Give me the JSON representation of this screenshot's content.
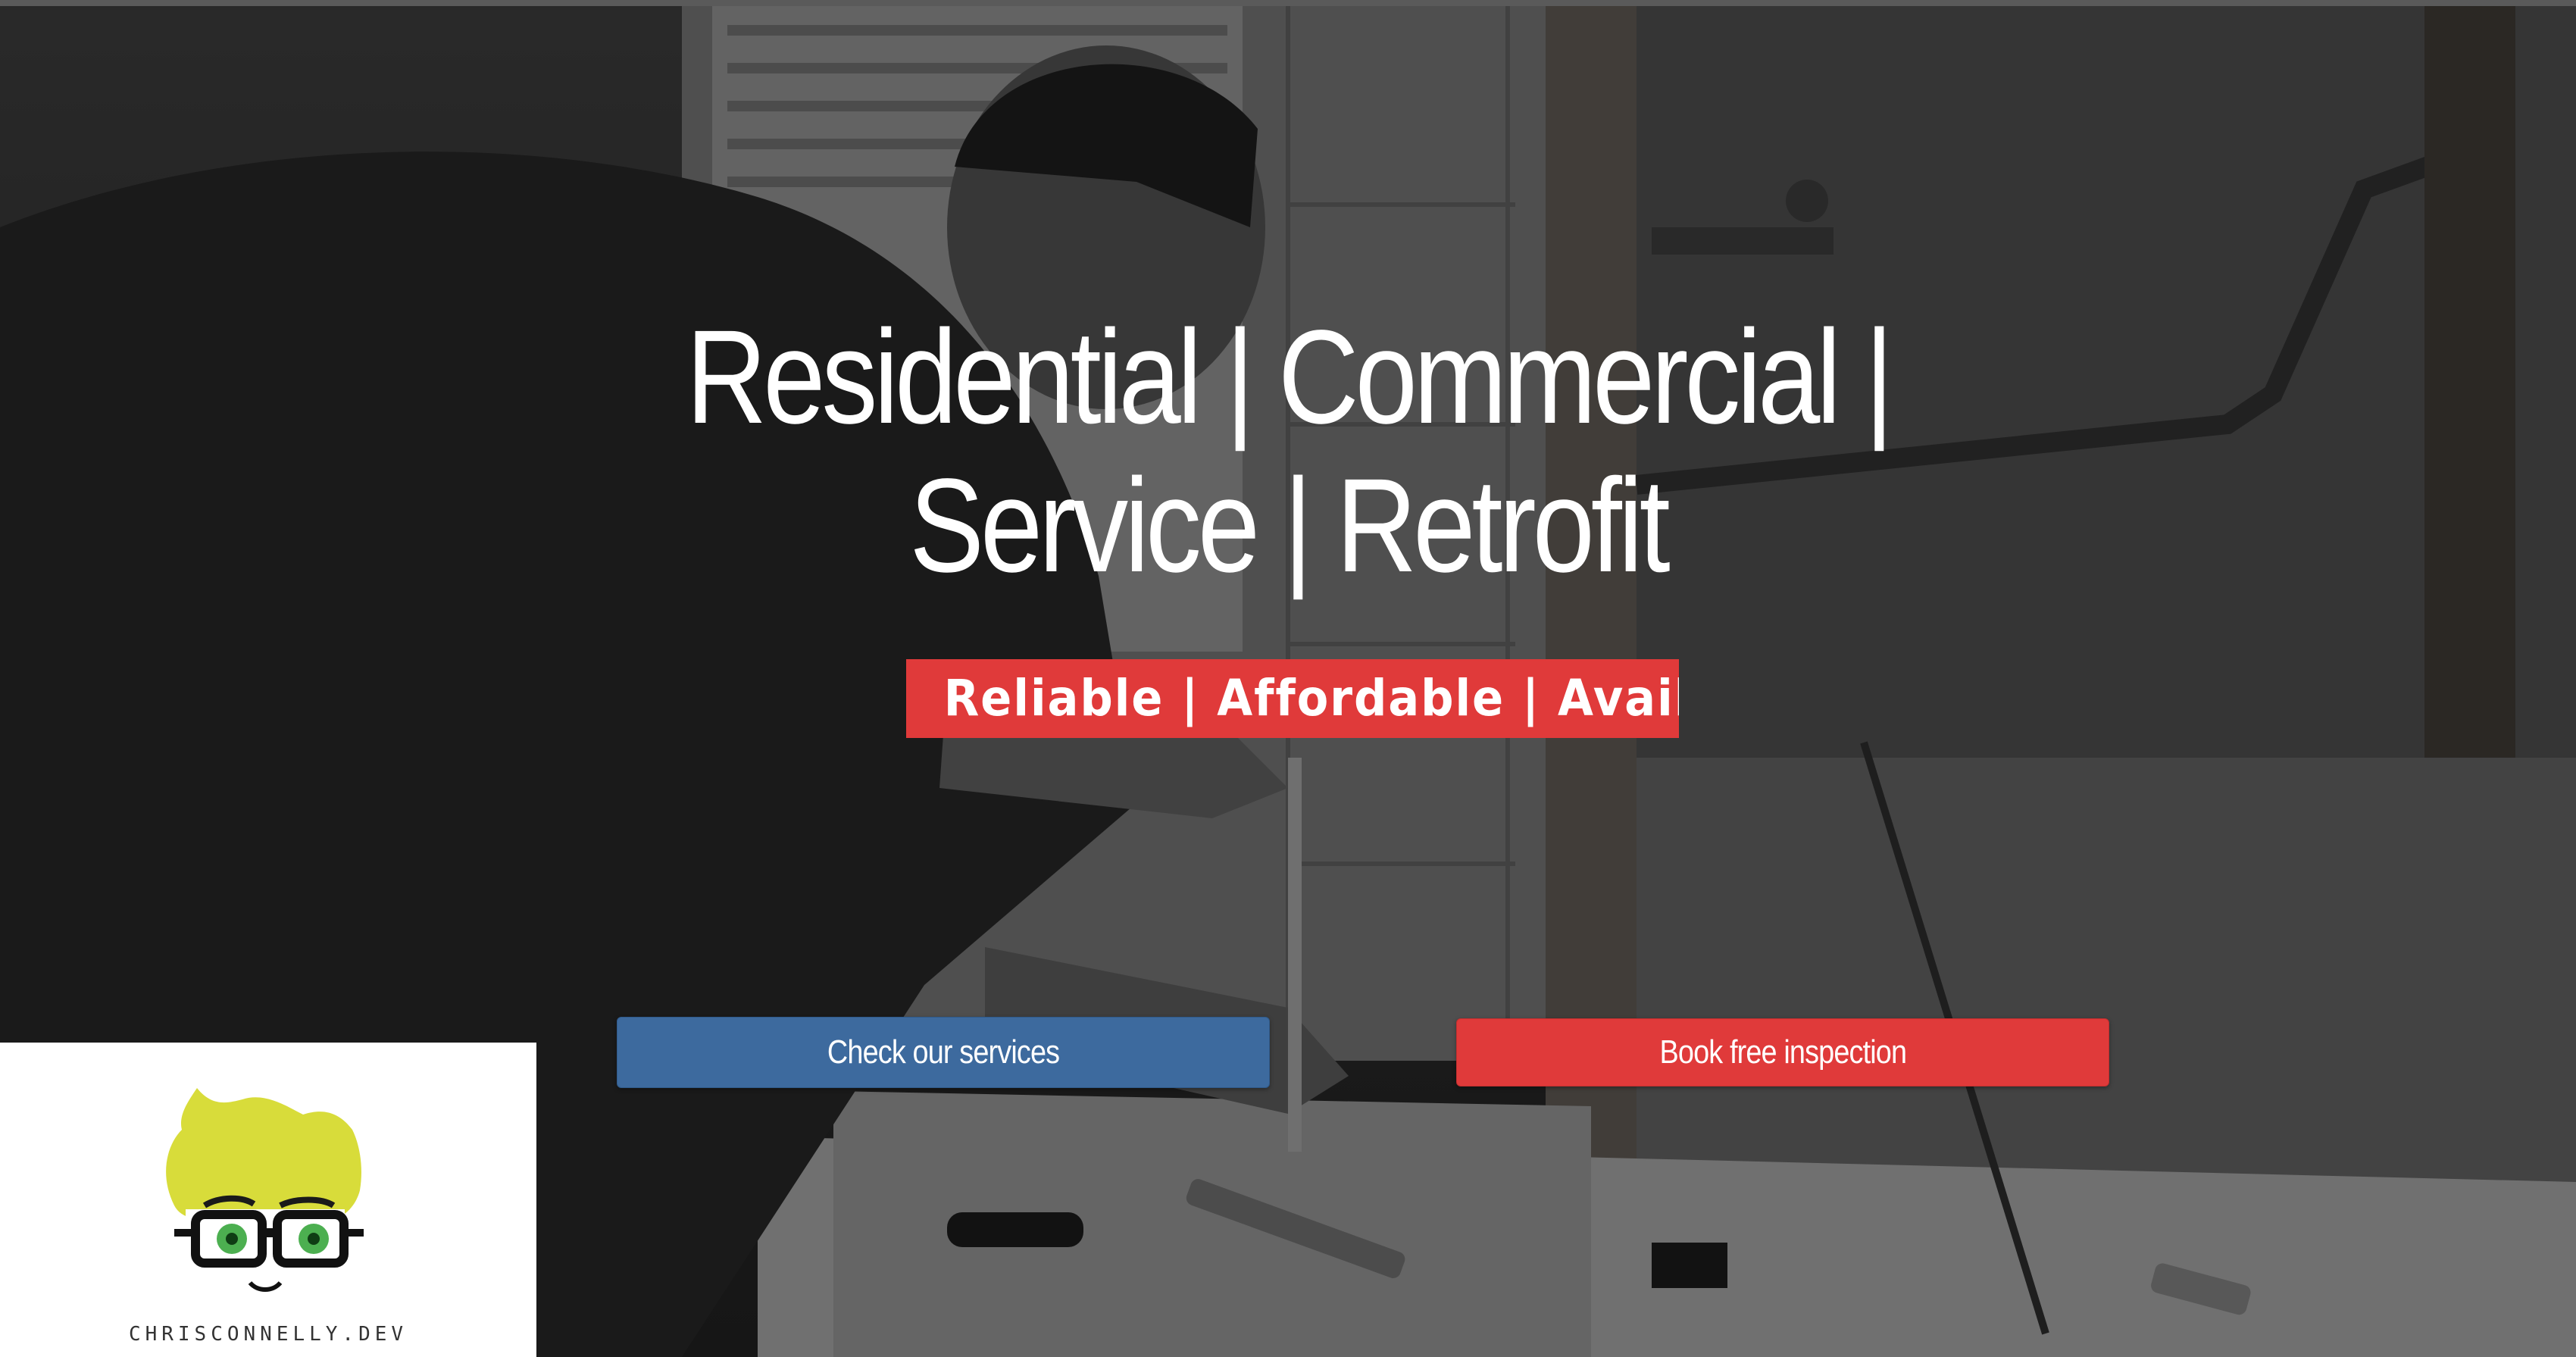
{
  "hero": {
    "headline_line1": "Residential | Commercial |",
    "headline_line2": "Service | Retrofit",
    "tagline": "Reliable | Affordable | Available"
  },
  "buttons": {
    "services_label": "Check our services",
    "inspection_label": "Book free inspection"
  },
  "logo": {
    "text": "CHRISCONNELLY.DEV"
  },
  "colors": {
    "accent_red": "#e03a3a",
    "accent_blue": "#3d6a9e",
    "logo_hair": "#d8dc3a",
    "logo_eyes": "#4caf50"
  }
}
